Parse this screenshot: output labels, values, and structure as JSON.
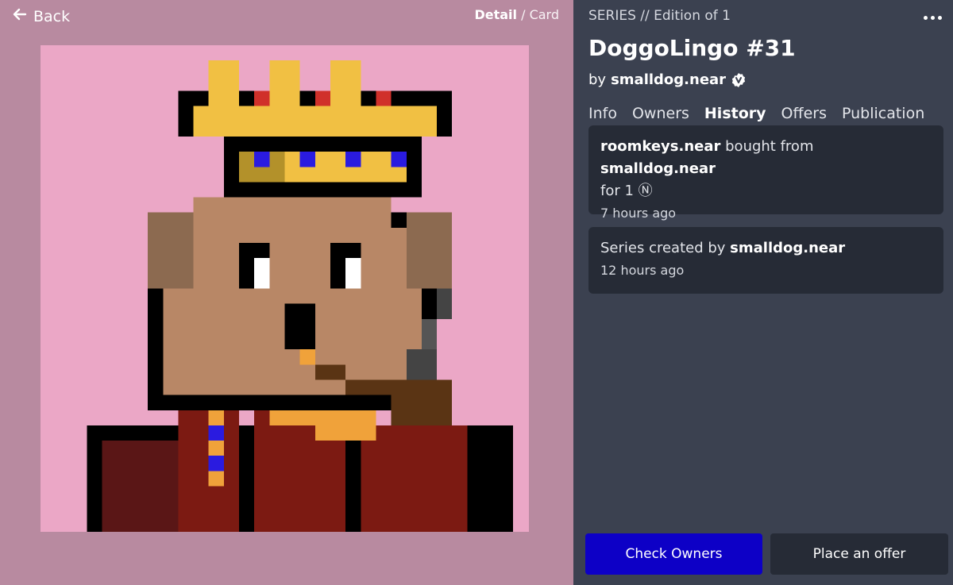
{
  "nav": {
    "back_label": "Back",
    "view_detail": "Detail",
    "view_separator": "/",
    "view_card": "Card"
  },
  "token": {
    "series_line": "SERIES // Edition of 1",
    "title": "DoggoLingo #31",
    "by_prefix": "by",
    "creator": "smalldog.near"
  },
  "tabs": [
    "Info",
    "Owners",
    "History",
    "Offers",
    "Publication"
  ],
  "active_tab": "History",
  "history": [
    {
      "buyer": "roomkeys.near",
      "action": " bought from ",
      "seller": "smalldog.near",
      "price": "for 1 Ⓝ",
      "time": "7 hours ago"
    },
    {
      "prefix": "Series created by ",
      "creator": "smalldog.near",
      "time": "12 hours ago"
    }
  ],
  "actions": {
    "primary": "Check Owners",
    "secondary": "Place an offer"
  },
  "colors": {
    "left_bg": "#b88aa0",
    "art_bg": "#eba7c6",
    "panel_bg": "#3b4150",
    "card_bg": "#262b36",
    "primary_btn": "#0d00c6"
  },
  "icons": [
    "back-arrow-icon",
    "verified-badge-icon",
    "more-options-icon"
  ]
}
